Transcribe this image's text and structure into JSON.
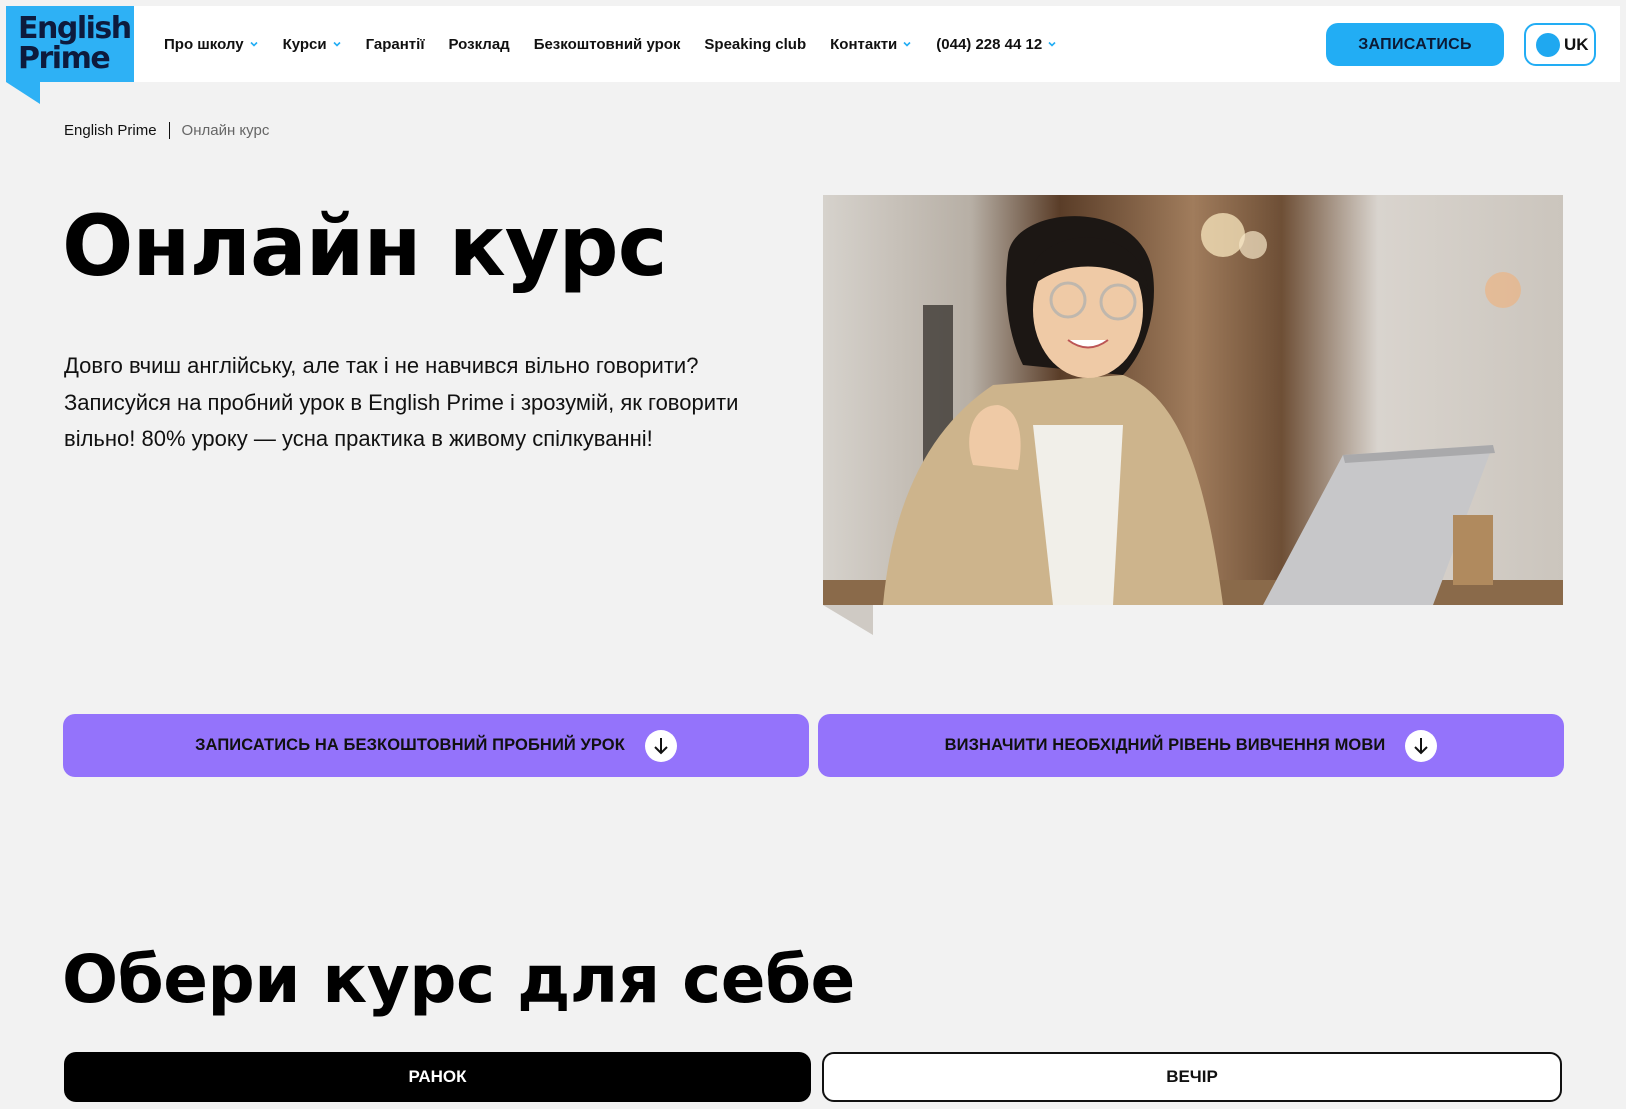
{
  "brand": {
    "logo_line1": "English",
    "logo_line2": "Prime",
    "accent_color": "#2eb1f5",
    "cta_color": "#9473fb"
  },
  "nav": {
    "items": [
      {
        "label": "Про школу",
        "has_dropdown": true
      },
      {
        "label": "Курси",
        "has_dropdown": true
      },
      {
        "label": "Гарантії",
        "has_dropdown": false
      },
      {
        "label": "Розклад",
        "has_dropdown": false
      },
      {
        "label": "Безкоштовний урок",
        "has_dropdown": false
      },
      {
        "label": "Speaking club",
        "has_dropdown": false
      },
      {
        "label": "Контакти",
        "has_dropdown": true
      },
      {
        "label": "(044) 228 44 12",
        "has_dropdown": true
      }
    ],
    "signup_label": "ЗАПИСАТИСЬ",
    "language_label": "UK"
  },
  "breadcrumb": {
    "home": "English Prime",
    "current": "Онлайн курс"
  },
  "hero": {
    "title": "Онлайн курс",
    "description": "Довго вчиш англійську, але так і не навчився вільно говорити? Записуйся на пробний урок в English Prime і зрозумій, як говорити вільно! 80% уроку — усна практика в живому спілкуванні!",
    "image_alt": "photo"
  },
  "cta": {
    "trial_label": "ЗАПИСАТИСЬ НА БЕЗКОШТОВНИЙ ПРОБНИЙ УРОК",
    "level_label": "ВИЗНАЧИТИ НЕОБХІДНИЙ РІВЕНЬ ВИВЧЕННЯ МОВИ"
  },
  "courses": {
    "title": "Обери курс для себе",
    "tabs": [
      {
        "label": "РАНОК",
        "active": true
      },
      {
        "label": "ВЕЧІР",
        "active": false
      }
    ]
  }
}
